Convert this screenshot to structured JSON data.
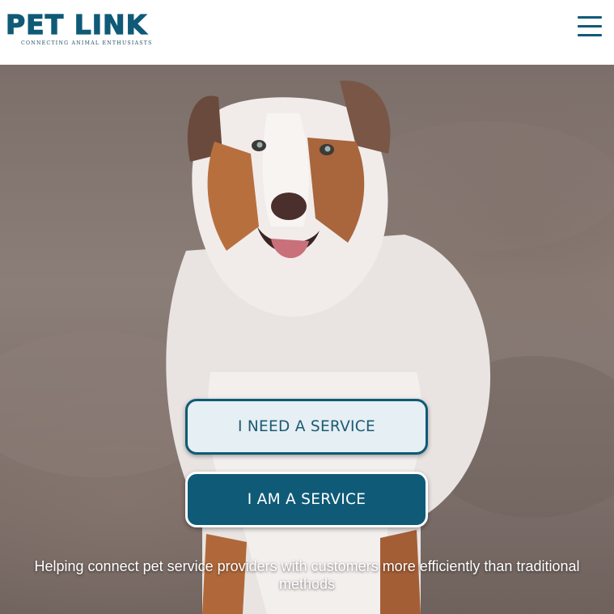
{
  "header": {
    "logo_text": "PET LINK",
    "logo_tagline": "Connecting Animal Enthusiasts",
    "menu_icon": "hamburger-menu-icon"
  },
  "hero": {
    "image": "australian-shepherd-dog-photo",
    "buttons": {
      "need_service": "I NEED A SERVICE",
      "am_service": "I AM A SERVICE"
    },
    "tagline": "Helping connect pet service providers with customers more efficiently than traditional methods"
  },
  "colors": {
    "brand": "#0f5a77",
    "button_light": "#e6eff3",
    "white": "#ffffff"
  }
}
